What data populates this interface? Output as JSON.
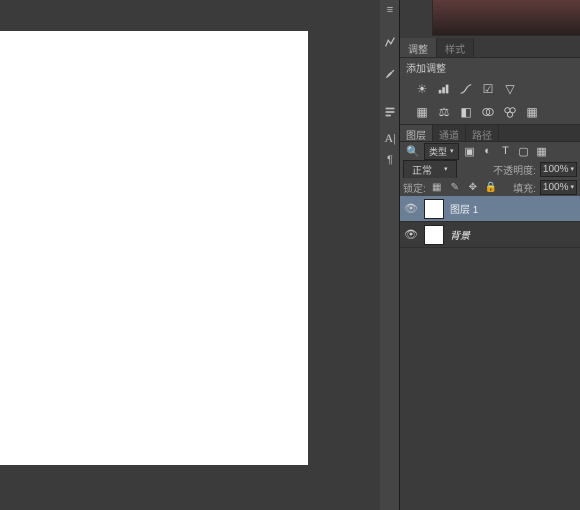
{
  "tabs_top": {
    "adjustments": "调整",
    "styles": "样式"
  },
  "adjustments_title": "添加调整",
  "layers_tabs": {
    "layers": "图层",
    "channels": "通道",
    "paths": "路径"
  },
  "filter_label": "类型",
  "blend_mode": "正常",
  "opacity_label": "不透明度:",
  "opacity_value": "100%",
  "lock_label": "锁定:",
  "fill_label": "填充:",
  "fill_value": "100%",
  "layers": [
    {
      "name": "图层 1",
      "selected": true,
      "italic": false
    },
    {
      "name": "背景",
      "selected": false,
      "italic": true
    }
  ]
}
